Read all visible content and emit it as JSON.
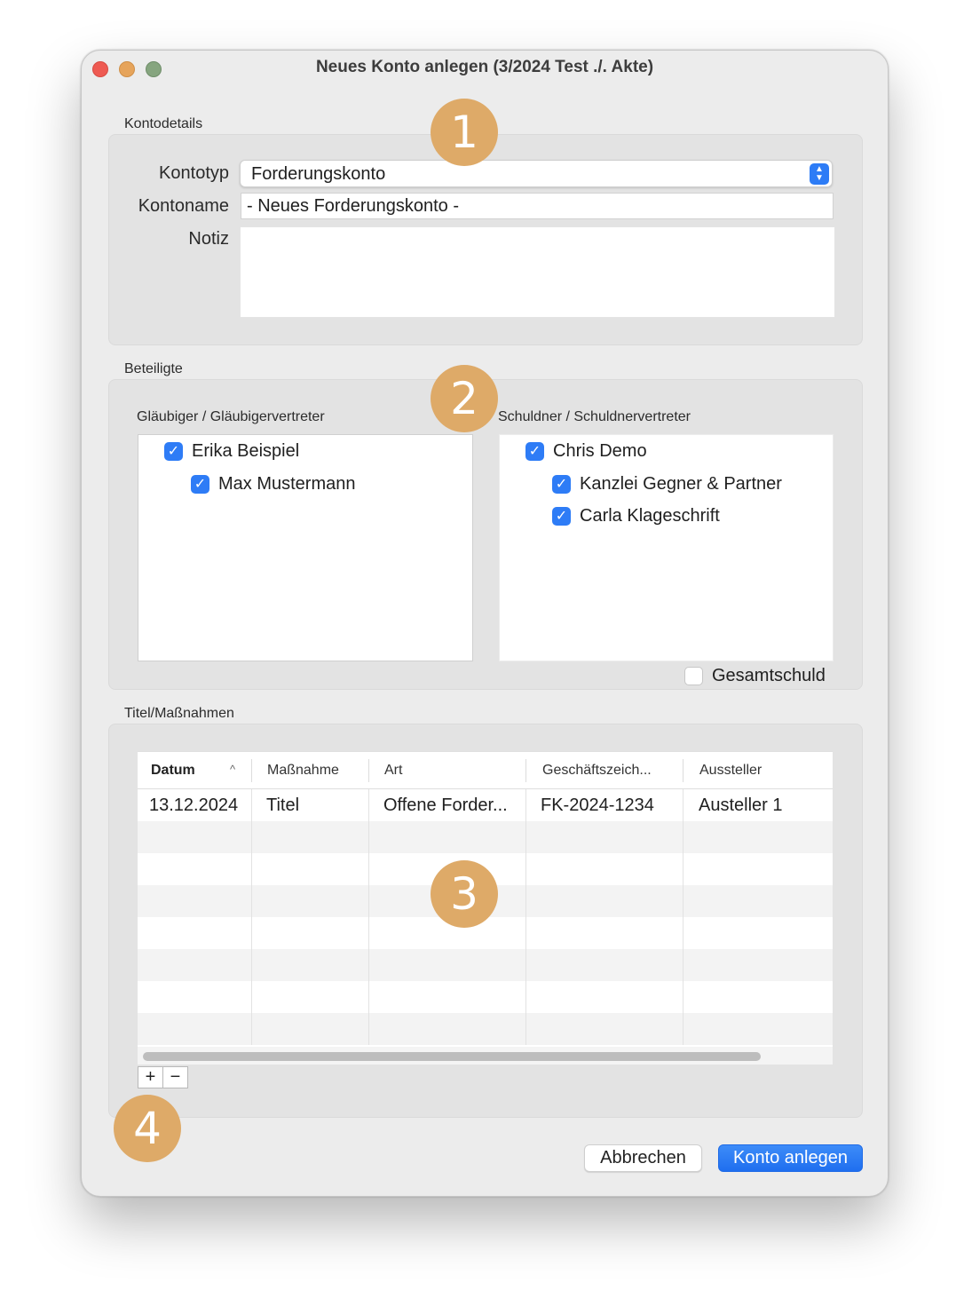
{
  "window": {
    "title": "Neues Konto anlegen (3/2024 Test ./. Akte)"
  },
  "kontodetails": {
    "section_title": "Kontodetails",
    "kontotyp_label": "Kontotyp",
    "kontotyp_value": "Forderungskonto",
    "kontoname_label": "Kontoname",
    "kontoname_value": "- Neues Forderungskonto -",
    "notiz_label": "Notiz",
    "notiz_value": ""
  },
  "beteiligte": {
    "section_title": "Beteiligte",
    "glaeubiger": {
      "title": "Gläubiger / Gläubigervertreter",
      "items": [
        {
          "label": "Erika Beispiel",
          "checked": true,
          "level": 0
        },
        {
          "label": "Max Mustermann",
          "checked": true,
          "level": 1
        }
      ]
    },
    "schuldner": {
      "title": "Schuldner / Schuldnervertreter",
      "items": [
        {
          "label": "Chris Demo",
          "checked": true,
          "level": 0
        },
        {
          "label": "Kanzlei Gegner & Partner",
          "checked": true,
          "level": 1
        },
        {
          "label": "Carla Klageschrift",
          "checked": true,
          "level": 1
        }
      ]
    },
    "gesamtschuld_label": "Gesamtschuld",
    "gesamtschuld_checked": false
  },
  "titel": {
    "section_title": "Titel/Maßnahmen",
    "columns": [
      "Datum",
      "Maßnahme",
      "Art",
      "Geschäftszeich...",
      "Aussteller"
    ],
    "sort_indicator": "^",
    "rows": [
      [
        "13.12.2024",
        "Titel",
        "Offene Forder...",
        "FK-2024-1234",
        "Austeller 1"
      ]
    ],
    "add_label": "+",
    "remove_label": "−"
  },
  "buttons": {
    "cancel": "Abbrechen",
    "create": "Konto anlegen"
  },
  "badges": [
    "1",
    "2",
    "3",
    "4"
  ],
  "colors": {
    "accent": "#2e7cf6",
    "badge": "#deaa68"
  }
}
